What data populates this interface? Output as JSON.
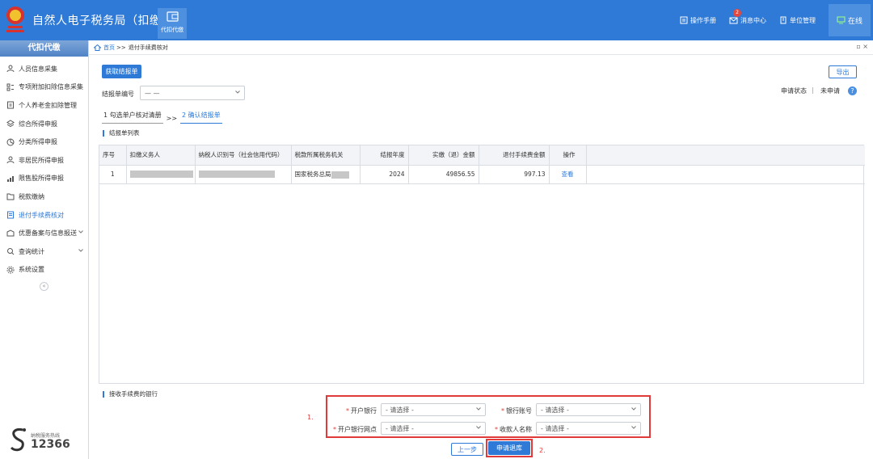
{
  "app": {
    "title": "自然人电子税务局（扣缴端）",
    "module_tab": "代扣代缴"
  },
  "header_right": {
    "manual": "操作手册",
    "messages": "消息中心",
    "messages_badge": "2",
    "unit_mgmt": "单位管理",
    "online": "在线"
  },
  "sidebar": {
    "title": "代扣代缴",
    "items": [
      {
        "label": "人员信息采集",
        "icon": "person-icon"
      },
      {
        "label": "专项附加扣除信息采集",
        "icon": "list-icon"
      },
      {
        "label": "个人养老金扣除管理",
        "icon": "pension-icon"
      },
      {
        "label": "综合所得申报",
        "icon": "layers-icon"
      },
      {
        "label": "分类所得申报",
        "icon": "pie-icon"
      },
      {
        "label": "非居民所得申报",
        "icon": "person-icon"
      },
      {
        "label": "限售股所得申报",
        "icon": "bar-chart-icon"
      },
      {
        "label": "税款缴纳",
        "icon": "folder-icon"
      },
      {
        "label": "退付手续费核对",
        "icon": "document-icon",
        "active": true
      },
      {
        "label": "优惠备案与信息报送",
        "icon": "chevron-down-icon"
      },
      {
        "label": "查询统计",
        "icon": "search-icon"
      },
      {
        "label": "系统设置",
        "icon": "gear-icon"
      }
    ],
    "hotline_label": "纳税服务热线",
    "hotline_number": "12366"
  },
  "breadcrumb": {
    "home": "首页",
    "sep": ">>",
    "current": "退付手续费核对"
  },
  "toolbar": {
    "fetch_button": "获取结报单",
    "export_button": "导出",
    "report_no_label": "结报单编号",
    "report_no_value": "— —",
    "status_label": "申请状态",
    "status_sep": "|",
    "status_value": "未申请",
    "help": "?"
  },
  "steps": {
    "step1": "1 勾选单户核对清册",
    "sep": ">>",
    "step2": "2 确认结报单"
  },
  "list_section_title": "结报单列表",
  "table": {
    "headers": [
      "序号",
      "扣缴义务人",
      "纳税人识别号（社会信用代码）",
      "税款所属税务机关",
      "结报年度",
      "实缴（退）金额",
      "退付手续费金额",
      "操作"
    ],
    "rows": [
      {
        "index": "1",
        "agent": "",
        "tax_id": "",
        "authority": "国家税务总局",
        "year": "2024",
        "paid_amount": "49856.55",
        "refund_fee": "997.13",
        "action": "查看"
      }
    ]
  },
  "bank_section_title": "接收手续费的银行",
  "bank_form": {
    "bank_label": "开户银行",
    "account_label": "银行账号",
    "branch_label": "开户银行网点",
    "payee_label": "收款人名称",
    "placeholder": "- 请选择 -",
    "required_mark": "*"
  },
  "annotations": {
    "box1": "1.",
    "box2": "2."
  },
  "footer_buttons": {
    "prev": "上一步",
    "submit": "申请退库"
  }
}
